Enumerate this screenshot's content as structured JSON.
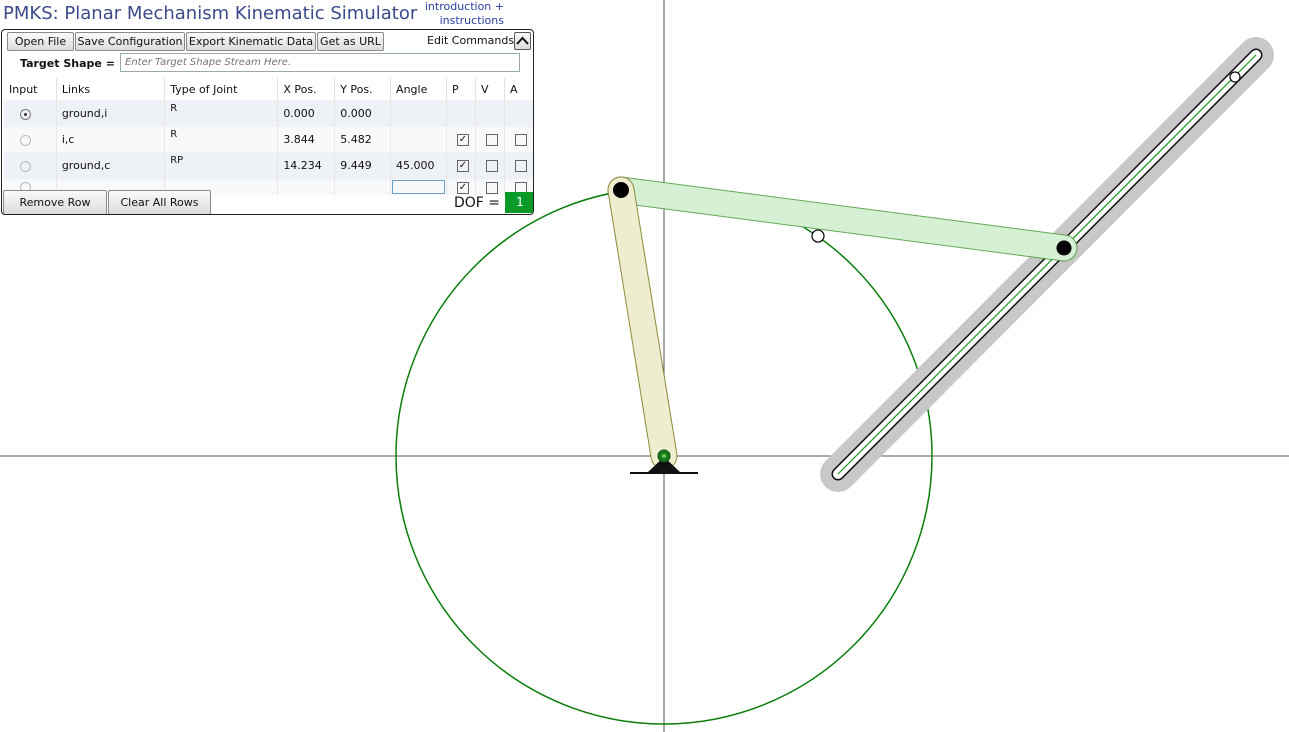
{
  "app": {
    "title": "PMKS: Planar Mechanism Kinematic Simulator",
    "help_link_line1": "introduction +",
    "help_link_line2": "instructions"
  },
  "toolbar": {
    "open_file": "Open File",
    "save_config": "Save Configuration",
    "export_data": "Export Kinematic Data",
    "get_url": "Get as URL",
    "edit_commands": "Edit Commands"
  },
  "target": {
    "label": "Target Shape =",
    "placeholder": "Enter Target Shape Stream Here."
  },
  "table": {
    "headers": [
      "Input",
      "Links",
      "Type of Joint",
      "X Pos.",
      "Y Pos.",
      "Angle",
      "P",
      "V",
      "A"
    ],
    "rows": [
      {
        "input": true,
        "links": "ground,i",
        "type": "R",
        "x": "0.000",
        "y": "0.000",
        "angle": "",
        "p": null,
        "v": null,
        "a": null
      },
      {
        "input": false,
        "links": "i,c",
        "type": "R",
        "x": "3.844",
        "y": "5.482",
        "angle": "",
        "p": true,
        "v": false,
        "a": false
      },
      {
        "input": false,
        "links": "ground,c",
        "type": "RP",
        "x": "14.234",
        "y": "9.449",
        "angle": "45.000",
        "p": true,
        "v": false,
        "a": false
      },
      {
        "input": false,
        "links": "",
        "type": "",
        "x": "",
        "y": "",
        "angle": "",
        "p": true,
        "v": false,
        "a": false
      }
    ]
  },
  "actions": {
    "remove_row": "Remove Row",
    "clear_all": "Clear All Rows"
  },
  "dof": {
    "label": "DOF =",
    "value": "1"
  },
  "colors": {
    "title_blue": "#3b4a8a",
    "path_green": "#0a7d0a",
    "link_i_fill": "#e8e7b8",
    "link_c_fill": "#cdeecb",
    "slider_gray": "#c8c8c8",
    "dof_green": "#0a9a2a"
  }
}
